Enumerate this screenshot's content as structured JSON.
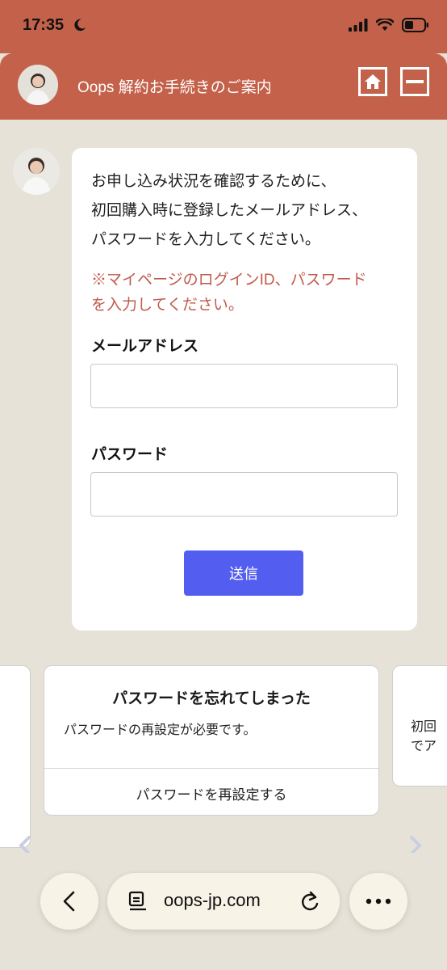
{
  "status": {
    "time": "17:35"
  },
  "header": {
    "title": "Oops 解約お手続きのご案内"
  },
  "message": {
    "lines": [
      "お申し込み状況を確認するために、",
      "初回購入時に登録したメールアドレス、",
      "パスワードを入力してください。"
    ],
    "notice_lines": [
      "※マイページのログインID、パスワード",
      "を入力してください。"
    ],
    "email_label": "メールアドレス",
    "email_value": "",
    "password_label": "パスワード",
    "password_value": "",
    "submit_label": "送信"
  },
  "carousel": {
    "main": {
      "title": "パスワードを忘れてしまった",
      "description": "パスワードの再設定が必要です。",
      "action": "パスワードを再設定する"
    },
    "right_peek": {
      "lines": [
        "初回",
        "でア"
      ]
    }
  },
  "browser": {
    "url": "oops-jp.com"
  },
  "colors": {
    "brand": "#c4614a",
    "background": "#e6e2d7",
    "submit": "#535ef0",
    "notice": "#c25a4c"
  }
}
